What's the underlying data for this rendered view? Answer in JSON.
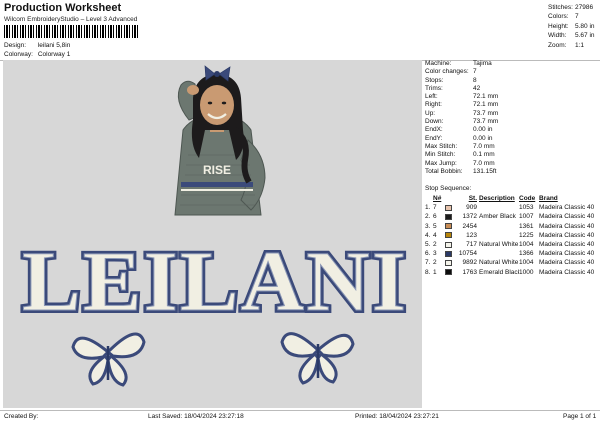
{
  "header": {
    "title": "Production Worksheet",
    "subtitle": "Wilcom EmbroideryStudio – Level 3 Advanced",
    "design_label": "Design:",
    "design_value": "leilani 5,8in",
    "colorway_label": "Colorway:",
    "colorway_value": "Colorway 1"
  },
  "stats": [
    {
      "label": "Stitches:",
      "value": "27986"
    },
    {
      "label": "Colors:",
      "value": "7"
    },
    {
      "label": "Height:",
      "value": "5.80 in"
    },
    {
      "label": "Width:",
      "value": "5.67 in"
    },
    {
      "label": "Zoom:",
      "value": "1:1"
    }
  ],
  "design": {
    "wordmark": "LEILANI",
    "shirt_text": "RISE",
    "colors": {
      "canvas": "#d7d7d7",
      "navy": "#3b4a7a",
      "cream": "#f1efe3",
      "sweater": "#6c7770",
      "skin": "#c99a72",
      "hair": "#1d1b1c"
    }
  },
  "machine": [
    {
      "label": "Machine:",
      "value": "Tajima"
    },
    {
      "label": "Color changes:",
      "value": "7"
    },
    {
      "label": "Stops:",
      "value": "8"
    },
    {
      "label": "Trims:",
      "value": "42"
    },
    {
      "label": "Left:",
      "value": "72.1 mm"
    },
    {
      "label": "Right:",
      "value": "72.1 mm"
    },
    {
      "label": "Up:",
      "value": "73.7 mm"
    },
    {
      "label": "Down:",
      "value": "73.7 mm"
    },
    {
      "label": "EndX:",
      "value": "0.00 in"
    },
    {
      "label": "EndY:",
      "value": "0.00 in"
    },
    {
      "label": "Max Stitch:",
      "value": "7.0 mm"
    },
    {
      "label": "Min Stitch:",
      "value": "0.1 mm"
    },
    {
      "label": "Max Jump:",
      "value": "7.0 mm"
    },
    {
      "label": "Total Bobbin:",
      "value": "131.15ft"
    }
  ],
  "stop_sequence": {
    "heading": "Stop Sequence:",
    "columns": {
      "n": "N#",
      "st": "St.",
      "desc": "Description",
      "code": "Code",
      "brand": "Brand"
    },
    "rows": [
      {
        "idx": "1.",
        "n": "7",
        "color": "#e8c4ad",
        "st": "909",
        "desc": "",
        "code": "1053",
        "brand": "Madeira Classic 40"
      },
      {
        "idx": "2.",
        "n": "6",
        "color": "#1c1c1c",
        "st": "1372",
        "desc": "Amber Black",
        "code": "1007",
        "brand": "Madeira Classic 40"
      },
      {
        "idx": "3.",
        "n": "5",
        "color": "#c98d56",
        "st": "2454",
        "desc": "",
        "code": "1361",
        "brand": "Madeira Classic 40"
      },
      {
        "idx": "4.",
        "n": "4",
        "color": "#b8860b",
        "st": "123",
        "desc": "",
        "code": "1225",
        "brand": "Madeira Classic 40"
      },
      {
        "idx": "5.",
        "n": "2",
        "color": "#f4f3ea",
        "st": "717",
        "desc": "Natural White",
        "code": "1004",
        "brand": "Madeira Classic 40"
      },
      {
        "idx": "6.",
        "n": "3",
        "color": "#2b3a67",
        "st": "10754",
        "desc": "",
        "code": "1366",
        "brand": "Madeira Classic 40"
      },
      {
        "idx": "7.",
        "n": "2",
        "color": "#f4f3ea",
        "st": "9892",
        "desc": "Natural White",
        "code": "1004",
        "brand": "Madeira Classic 40"
      },
      {
        "idx": "8.",
        "n": "1",
        "color": "#0d0d0d",
        "st": "1763",
        "desc": "Emerald Black",
        "code": "1000",
        "brand": "Madeira Classic 40"
      }
    ]
  },
  "footer": {
    "created_by": "Created By:",
    "last_saved": "Last Saved: 18/04/2024 23:27:18",
    "printed": "Printed: 18/04/2024 23:27:21",
    "page": "Page 1 of 1"
  }
}
